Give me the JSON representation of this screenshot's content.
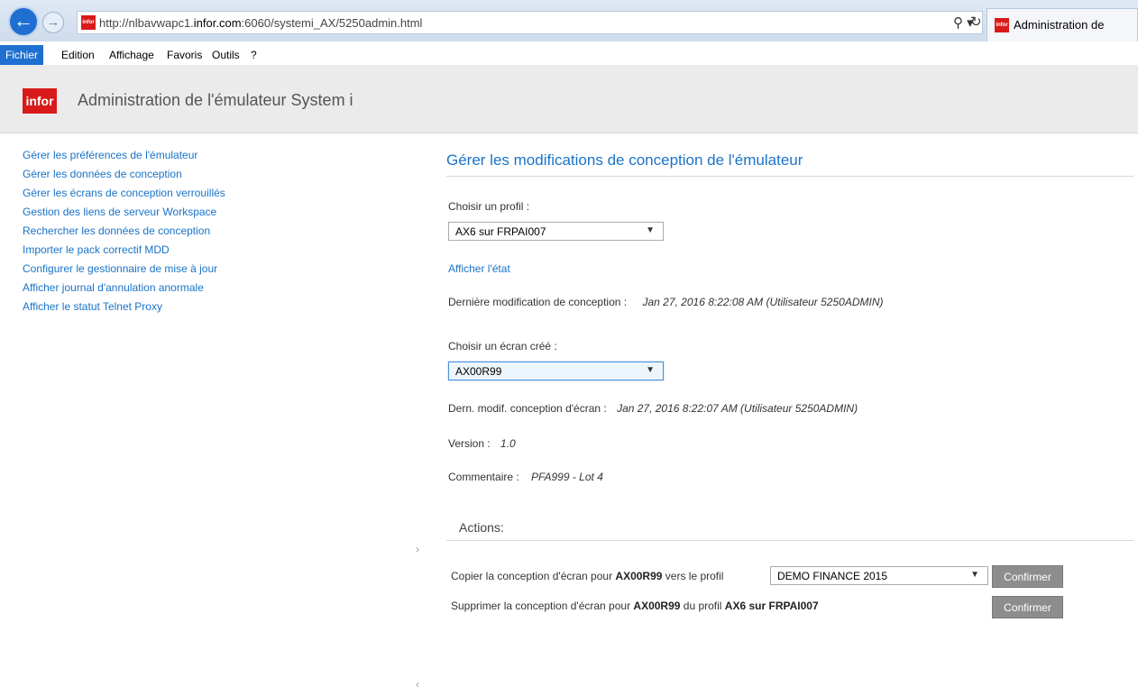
{
  "browser": {
    "url_prefix": "http://nlbavwapc1.",
    "url_domain": "infor.com",
    "url_suffix": ":6060/systemi_AX/5250admin.html",
    "tab_title": "Administration de",
    "favicon_text": "infor",
    "back_icon": "←",
    "forward_icon": "→",
    "search_icon": "⚲ ▾",
    "refresh_icon": "↻"
  },
  "menubar": {
    "items": [
      "Fichier",
      "Edition",
      "Affichage",
      "Favoris",
      "Outils",
      "?"
    ]
  },
  "header": {
    "logo": "infor",
    "title": "Administration de l'émulateur System i"
  },
  "sidebar": {
    "items": [
      "Gérer les préférences de l'émulateur",
      "Gérer les données de conception",
      "Gérer les écrans de conception verrouillés",
      "Gestion des liens de serveur Workspace",
      "Rechercher les données de conception",
      "Importer le pack correctif MDD",
      "Configurer le gestionnaire de mise à jour",
      "Afficher journal d'annulation anormale",
      "Afficher le statut Telnet Proxy"
    ],
    "collapse_icon": "›",
    "collapse_icon_2": "‹"
  },
  "main": {
    "title": "Gérer les modifications de conception de l'émulateur",
    "profile_label": "Choisir un profil :",
    "profile_value": "AX6 sur FRPAI007",
    "show_state_link": "Afficher l'état",
    "last_mod_label": "Dernière modification de conception :",
    "last_mod_value": "Jan 27, 2016 8:22:08 AM (Utilisateur 5250ADMIN)",
    "screen_label": "Choisir un écran créé :",
    "screen_value": "AX00R99",
    "screen_mod_label": "Dern. modif. conception d'écran :",
    "screen_mod_value": "Jan 27, 2016 8:22:07 AM (Utilisateur 5250ADMIN)",
    "version_label": "Version :",
    "version_value": "1.0",
    "comment_label": "Commentaire :",
    "comment_value": "PFA999 - Lot 4"
  },
  "actions": {
    "title": "Actions:",
    "copy_prefix": "Copier la conception d'écran pour ",
    "copy_screen": "AX00R99",
    "copy_middle": " vers le profil",
    "copy_target_value": "DEMO FINANCE 2015",
    "copy_button": "Confirmer",
    "delete_prefix": "Supprimer la conception d'écran pour ",
    "delete_screen": "AX00R99",
    "delete_middle": " du profil ",
    "delete_profile": "AX6 sur FRPAI007",
    "delete_button": "Confirmer"
  }
}
